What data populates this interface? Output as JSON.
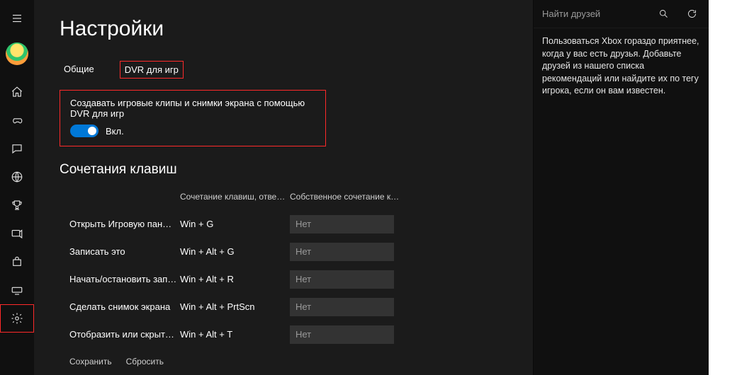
{
  "page_title": "Настройки",
  "tabs": [
    "Общие",
    "DVR для игр"
  ],
  "active_tab_index": 1,
  "dvr_toggle": {
    "label": "Создавать игровые клипы и снимки экрана с помощью DVR для игр",
    "state": "Вкл."
  },
  "section_title": "Сочетания клавиш",
  "headers": {
    "default": "Сочетание клавиш, отве…",
    "custom": "Собственное сочетание к…"
  },
  "rows": [
    {
      "action": "Открыть Игровую пан…",
      "default": "Win + G",
      "custom": "Нет"
    },
    {
      "action": "Записать это",
      "default": "Win + Alt + G",
      "custom": "Нет"
    },
    {
      "action": "Начать/остановить зап…",
      "default": "Win + Alt + R",
      "custom": "Нет"
    },
    {
      "action": "Сделать снимок экрана",
      "default": "Win + Alt + PrtScn",
      "custom": "Нет"
    },
    {
      "action": "Отобразить или скрыт…",
      "default": "Win + Alt + T",
      "custom": "Нет"
    }
  ],
  "footer": {
    "save": "Сохранить",
    "reset": "Сбросить"
  },
  "side": {
    "search_placeholder": "Найти друзей",
    "text": "Пользоваться Xbox гораздо приятнее, когда у вас есть друзья. Добавьте друзей из нашего списка рекомендаций или найдите их по тегу игрока, если он вам известен."
  }
}
